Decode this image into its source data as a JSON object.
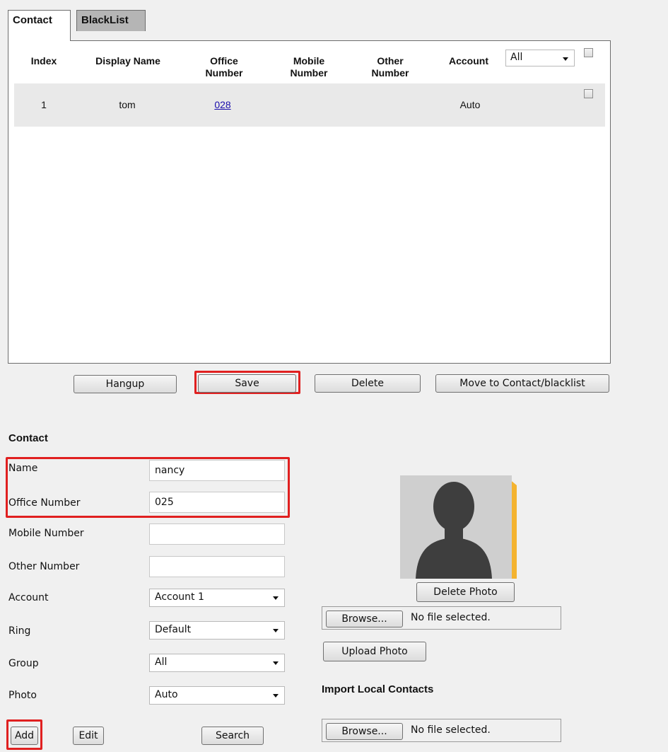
{
  "tabs": {
    "contact": "Contact",
    "blacklist": "BlackList"
  },
  "table": {
    "headers": {
      "index": "Index",
      "display_name": "Display Name",
      "office_1": "Office",
      "office_2": "Number",
      "mobile_1": "Mobile",
      "mobile_2": "Number",
      "other_1": "Other",
      "other_2": "Number",
      "account": "Account"
    },
    "account_filter": "All",
    "rows": [
      {
        "index": "1",
        "display_name": "tom",
        "office": "028",
        "mobile": "",
        "other": "",
        "account": "Auto"
      }
    ]
  },
  "actions": {
    "hangup": "Hangup",
    "save": "Save",
    "delete": "Delete",
    "move": "Move to Contact/blacklist"
  },
  "form": {
    "title": "Contact",
    "name_label": "Name",
    "name_value": "nancy",
    "office_label": "Office Number",
    "office_value": "025",
    "mobile_label": "Mobile Number",
    "mobile_value": "",
    "other_label": "Other Number",
    "other_value": "",
    "account_label": "Account",
    "account_value": "Account 1",
    "ring_label": "Ring",
    "ring_value": "Default",
    "group_label": "Group",
    "group_value": "All",
    "photo_label": "Photo",
    "photo_value": "Auto",
    "add": "Add",
    "edit": "Edit",
    "search": "Search"
  },
  "photo": {
    "delete": "Delete Photo",
    "browse": "Browse...",
    "no_file": "No file selected.",
    "upload": "Upload Photo",
    "avatar_icon": "person-silhouette-icon",
    "accent": "#f4b32f"
  },
  "import": {
    "title": "Import Local Contacts",
    "browse": "Browse...",
    "no_file": "No file selected."
  },
  "colors": {
    "highlight": "#e02020",
    "link": "#1a0dab",
    "row_bg": "#e9e9e9"
  }
}
